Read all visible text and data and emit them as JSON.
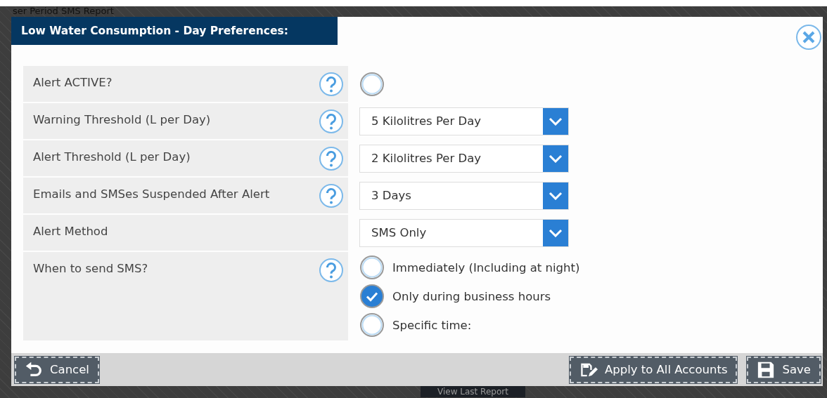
{
  "background": {
    "heading": "ser Period SMS Report",
    "button": "View Last Report"
  },
  "dialog": {
    "title": "Low Water Consumption - Day Preferences:",
    "rows": [
      {
        "label": "Alert ACTIVE?",
        "help": true,
        "kind": "radio",
        "checked": false
      },
      {
        "label": "Warning Threshold (L per Day)",
        "help": true,
        "kind": "select",
        "value": "5 Kilolitres Per Day"
      },
      {
        "label": "Alert Threshold (L per Day)",
        "help": true,
        "kind": "select",
        "value": "2 Kilolitres Per Day"
      },
      {
        "label": "Emails and SMSes Suspended After Alert",
        "help": true,
        "kind": "select",
        "value": "3 Days"
      },
      {
        "label": "Alert Method",
        "help": false,
        "kind": "select",
        "value": "SMS Only"
      },
      {
        "label": "When to send SMS?",
        "help": true,
        "kind": "radio-group",
        "options": [
          {
            "label": "Immediately (Including at night)",
            "selected": false
          },
          {
            "label": "Only during business hours",
            "selected": true
          },
          {
            "label": "Specific time:",
            "selected": false
          }
        ]
      }
    ],
    "buttons": [
      {
        "kind": "cancel",
        "label": "Cancel"
      },
      {
        "kind": "apply",
        "label": "Apply to All Accounts"
      },
      {
        "kind": "save",
        "label": "Save"
      }
    ]
  }
}
